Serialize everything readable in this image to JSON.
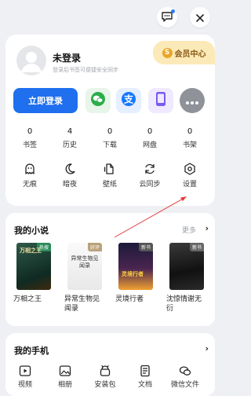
{
  "topbar": {
    "message_icon": "chat-icon",
    "close_icon": "close-icon"
  },
  "vip": {
    "label": "会员中心",
    "coin": "S"
  },
  "profile": {
    "title": "未登录",
    "subtitle": "登录后书签可便捷安全同步"
  },
  "login": {
    "button_label": "立即登录"
  },
  "social": [
    "wechat-icon",
    "alipay-icon",
    "phone-icon",
    "more-icon"
  ],
  "stats": [
    {
      "value": "0",
      "label": "书签"
    },
    {
      "value": "4",
      "label": "历史"
    },
    {
      "value": "0",
      "label": "下载"
    },
    {
      "value": "0",
      "label": "网盘"
    },
    {
      "value": "0",
      "label": "书架"
    }
  ],
  "tools": [
    {
      "label": "无痕",
      "icon": "ghost-icon"
    },
    {
      "label": "暗夜",
      "icon": "moon-icon"
    },
    {
      "label": "壁纸",
      "icon": "wallpaper-icon"
    },
    {
      "label": "云同步",
      "icon": "sync-icon"
    },
    {
      "label": "设置",
      "icon": "settings-icon"
    }
  ],
  "novels": {
    "title": "我的小说",
    "more": "更多",
    "books": [
      {
        "title": "万相之王",
        "tag": "热搜",
        "cover_text": "万相之王"
      },
      {
        "title": "异常生物见闻录",
        "tag": "好评",
        "cover_text": "异常生物见闻录"
      },
      {
        "title": "灵境行者",
        "tag": "新书",
        "cover_text": "灵境行者"
      },
      {
        "title": "沈惊情谢无衍",
        "tag": "新书",
        "cover_text": ""
      }
    ]
  },
  "phone": {
    "title": "我的手机",
    "items": [
      {
        "label": "视频",
        "icon": "video-icon"
      },
      {
        "label": "相册",
        "icon": "album-icon"
      },
      {
        "label": "安装包",
        "icon": "package-icon"
      },
      {
        "label": "文档",
        "icon": "document-icon"
      },
      {
        "label": "微信文件",
        "icon": "wechat-file-icon"
      }
    ]
  },
  "colors": {
    "primary": "#1f6fee",
    "annotation": "#e23b3b",
    "vip_bg": "#fbe9b8"
  }
}
